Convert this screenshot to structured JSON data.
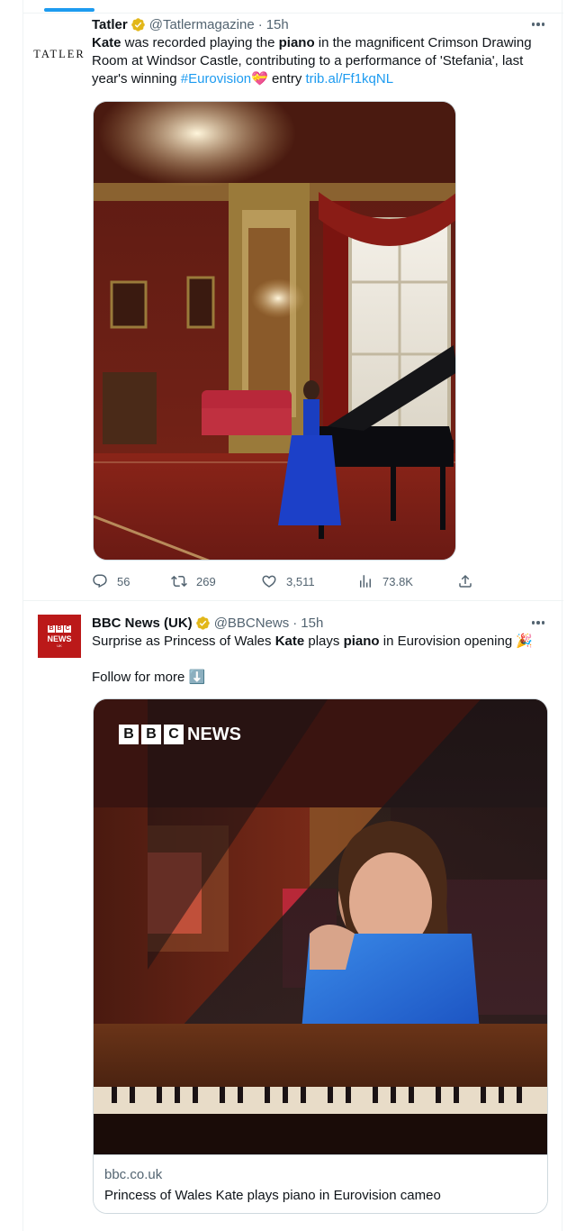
{
  "tweets": [
    {
      "author": "Tatler",
      "handle": "@Tatlermagazine",
      "time": "15h",
      "avatar_text": "TATLER",
      "text": {
        "kate": "Kate",
        "t1": " was recorded playing the ",
        "piano": "piano",
        "t2": " in the magnificent Crimson Drawing Room at Windsor Castle, contributing to a performance of 'Stefania', last year's winning ",
        "hashtag": "#Eurovision",
        "heart": "💝",
        "t3": " entry ",
        "link": "trib.al/Ff1kqNL"
      },
      "stats": {
        "replies": "56",
        "retweets": "269",
        "likes": "3,511",
        "views": "73.8K"
      }
    },
    {
      "author": "BBC News (UK)",
      "handle": "@BBCNews",
      "time": "15h",
      "avatar_text": {
        "b1": "B",
        "b2": "B",
        "b3": "C",
        "news": "NEWS",
        "uk": "UK"
      },
      "text": {
        "t1": "Surprise as Princess of Wales ",
        "kate": "Kate",
        "t2": " plays ",
        "piano": "piano",
        "t3": " in Eurovision opening ",
        "party": "🎉",
        "follow": "Follow for more ",
        "arrow": "⬇️"
      },
      "image_logo": {
        "b1": "B",
        "b2": "B",
        "b3": "C",
        "news": "NEWS"
      },
      "card": {
        "domain": "bbc.co.uk",
        "title": "Princess of Wales Kate plays piano in Eurovision cameo"
      }
    }
  ],
  "colors": {
    "accent": "#1d9bf0",
    "muted": "#536471",
    "bbc_red": "#bb1919"
  },
  "icons": [
    "verified-badge-icon",
    "more-icon",
    "reply-icon",
    "retweet-icon",
    "like-icon",
    "views-icon",
    "share-icon"
  ]
}
